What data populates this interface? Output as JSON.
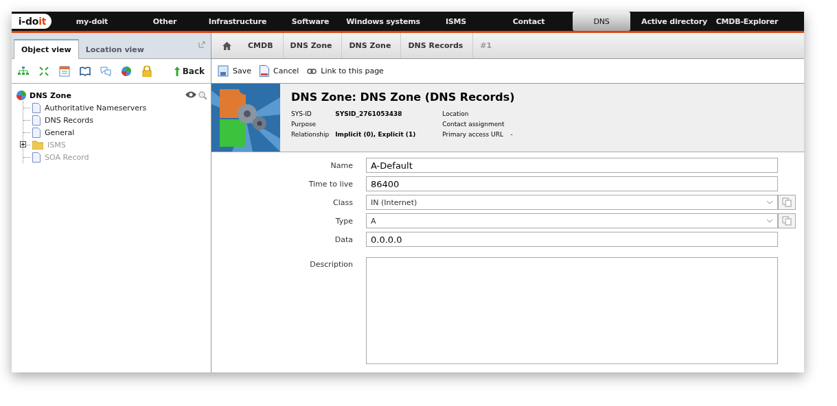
{
  "logo": {
    "text_a": "i-do",
    "text_b": "it"
  },
  "nav": [
    {
      "label": "my-doit",
      "selected": false
    },
    {
      "label": "Other",
      "selected": false
    },
    {
      "label": "Infrastructure",
      "selected": false
    },
    {
      "label": "Software",
      "selected": false
    },
    {
      "label": "Windows systems",
      "selected": false
    },
    {
      "label": "ISMS",
      "selected": false
    },
    {
      "label": "Contact",
      "selected": false
    },
    {
      "label": "DNS",
      "selected": true
    },
    {
      "label": "Active directory",
      "selected": false
    },
    {
      "label": "CMDB-Explorer",
      "selected": false
    }
  ],
  "sidebar": {
    "tabs": [
      {
        "label": "Object view",
        "selected": true
      },
      {
        "label": "Location view",
        "selected": false
      }
    ],
    "back": "Back",
    "tree": {
      "label": "DNS Zone",
      "children": [
        {
          "label": "Authoritative Nameservers",
          "kind": "page",
          "disabled": false
        },
        {
          "label": "DNS Records",
          "kind": "page",
          "disabled": false
        },
        {
          "label": "General",
          "kind": "page",
          "disabled": false
        },
        {
          "label": "ISMS",
          "kind": "folder",
          "disabled": true,
          "expanded": false
        },
        {
          "label": "SOA Record",
          "kind": "page",
          "disabled": true
        }
      ]
    }
  },
  "breadcrumb": [
    "CMDB",
    "DNS Zone",
    "DNS Zone",
    "DNS Records",
    "#1"
  ],
  "actions": [
    {
      "label": "Save",
      "kind": "save"
    },
    {
      "label": "Cancel",
      "kind": "cancel"
    },
    {
      "label": "Link to this page",
      "kind": "link"
    }
  ],
  "header": {
    "title": "DNS Zone: DNS Zone (DNS Records)",
    "left": [
      {
        "label": "SYS-ID",
        "value": "SYSID_2761053438"
      },
      {
        "label": "Purpose"
      },
      {
        "label": "Relationship",
        "value": "Implicit (0), Explicit (1)"
      }
    ],
    "right": [
      {
        "label": "Location"
      },
      {
        "label": "Contact assignment"
      },
      {
        "label": "Primary access URL",
        "value": "-"
      }
    ]
  },
  "form": [
    {
      "label": "Name",
      "kind": "text",
      "value": "A-Default"
    },
    {
      "label": "Time to live",
      "kind": "text",
      "value": "86400"
    },
    {
      "label": "Class",
      "kind": "select",
      "value": "IN (Internet)"
    },
    {
      "label": "Type",
      "kind": "select",
      "value": "A"
    },
    {
      "label": "Data",
      "kind": "text",
      "value": "0.0.0.0"
    },
    {
      "label": "Description",
      "kind": "textarea"
    }
  ]
}
